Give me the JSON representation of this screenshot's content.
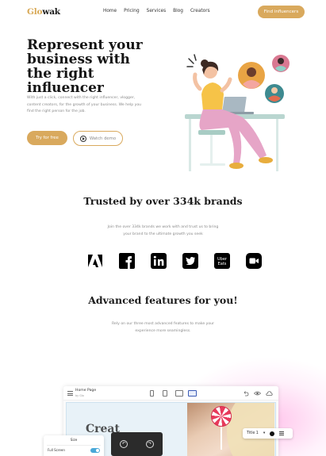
{
  "header": {
    "logo_prefix": "Glo",
    "logo_suffix": "wak",
    "nav": [
      "Home",
      "Pricing",
      "Services",
      "Blog",
      "Creators"
    ],
    "cta": "Find influencers"
  },
  "hero": {
    "title": "Represent your business with the right influencer",
    "subtitle": "With just a click, connect with the right influencer, vlogger, content creators, for the growth of your business. We help you find the right person for the job.",
    "primary_button": "Try for free",
    "secondary_button": "Watch demo"
  },
  "trusted": {
    "title": "Trusted by over 334k brands",
    "subtitle": "Join the over 334k brands we work with and trust us to bring your brand to the ultimate growth you seek",
    "brands": [
      "adobe-icon",
      "facebook-icon",
      "linkedin-icon",
      "twitter-icon",
      "uber-eats-icon",
      "video-icon"
    ],
    "uber_eats_text": [
      "Uber",
      "Eats"
    ]
  },
  "features": {
    "title": "Advanced features for you!",
    "subtitle": "Rely on our three most advanced features to make your experience more seamingless."
  },
  "editor": {
    "page_name": "Home Page",
    "page_sub": "by Glo",
    "canvas_heading": "Creat",
    "size_label": "Size",
    "full_screen_label": "Full Screen",
    "title_select": "Title 1",
    "accent": "#d9a95d",
    "toggle_color": "#49a8d8"
  }
}
